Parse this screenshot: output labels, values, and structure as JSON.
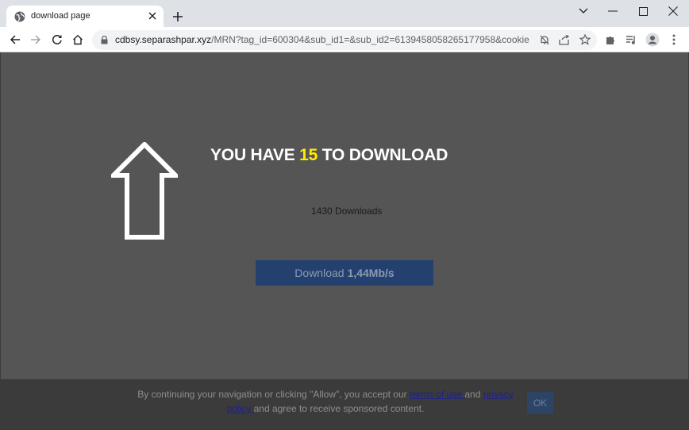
{
  "browser": {
    "tab": {
      "title": "download page"
    },
    "url": {
      "host": "cdbsy.separashpar.xyz",
      "path": "/MRN?tag_id=600304&sub_id1=&sub_id2=6139458058265177958&cookie_id..."
    }
  },
  "page": {
    "headline_before": "YOU HAVE ",
    "headline_number": "15",
    "headline_after": " TO DOWNLOAD",
    "downloads_text": "1430 Downloads",
    "download_button": {
      "label": "Download",
      "speed": "1,44Mb/s"
    }
  },
  "consent": {
    "text_1": "By continuing your navigation or clicking \"Allow\", you accept our ",
    "terms_link": "terms of use ",
    "text_2": "and ",
    "privacy_link": "privacy policy ",
    "text_3": "and agree to receive sponsored content.",
    "ok_label": "OK"
  },
  "colors": {
    "overlay": "#555555",
    "headline_accent": "#ffeb00",
    "download_button": "#24406f"
  }
}
